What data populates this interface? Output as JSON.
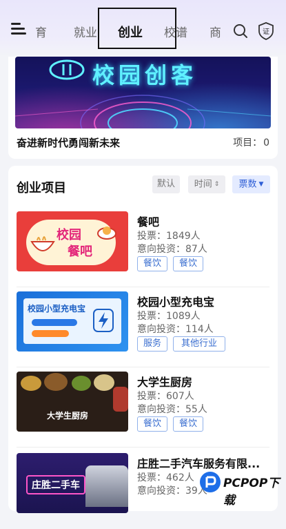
{
  "nav": {
    "tabs": [
      {
        "label": "育",
        "partial": true
      },
      {
        "label": "就业"
      },
      {
        "label": "创业",
        "active": true
      },
      {
        "label": "校谱"
      },
      {
        "label": "商",
        "partial": true
      }
    ],
    "icons": [
      "menu-icon",
      "search-icon",
      "certificate-icon"
    ],
    "cert_label": "证",
    "accent": "#2f5fd6"
  },
  "banner": {
    "image_text": "校园创客",
    "title": "奋进新时代勇闯新未来",
    "count_label": "项目：",
    "count_value": "0"
  },
  "projects": {
    "section_title": "创业项目",
    "sort": [
      {
        "label": "默认"
      },
      {
        "label": "时间",
        "icon": "sort-arrows-icon"
      },
      {
        "label": "票数",
        "icon": "sort-down-icon",
        "active": true
      }
    ],
    "items": [
      {
        "name": "餐吧",
        "votes": "投票：1849人",
        "intent": "意向投资：87人",
        "tags": [
          "餐饮",
          "餐饮"
        ],
        "thumb_text": [
          "校园",
          "餐吧"
        ]
      },
      {
        "name": "校园小型充电宝",
        "votes": "投票：1089人",
        "intent": "意向投资：114人",
        "tags": [
          "服务",
          "其他行业"
        ],
        "thumb_text": [
          "校园小型充电宝"
        ]
      },
      {
        "name": "大学生厨房",
        "votes": "投票：607人",
        "intent": "意向投资：55人",
        "tags": [
          "餐饮",
          "餐饮"
        ],
        "thumb_text": [
          "大学生厨房"
        ]
      },
      {
        "name": "庄胜二手汽车服务有限...",
        "votes": "投票：462人",
        "intent": "意向投资：39人",
        "tags": [],
        "thumb_text": [
          "庄胜二手车"
        ]
      }
    ]
  },
  "watermark": {
    "text": "PCPOP下载"
  }
}
